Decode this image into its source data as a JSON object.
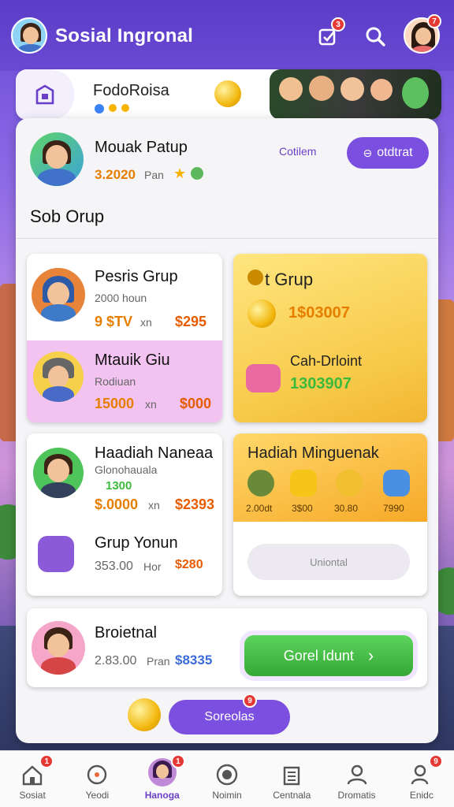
{
  "app": {
    "title": "Sosial Ingronal"
  },
  "topbar": {
    "notify_badge": "3",
    "profile_badge": "7"
  },
  "banner": {
    "title": "FodoRoisa"
  },
  "profile": {
    "name": "Mouak Patup",
    "value": "3.2020",
    "value_suffix": "Pan",
    "link": "Cotilem",
    "button": "otdtrat"
  },
  "section_title": "Sob Orup",
  "groups_card": {
    "items": [
      {
        "name": "Pesris Grup",
        "sub": "2000 houn",
        "price_left": "9 $TV",
        "price_mid": "xn",
        "price_right": "$295"
      },
      {
        "name": "Mtauik Giu",
        "sub": "Rodiuan",
        "price_left": "15000",
        "price_mid": "xn",
        "price_right": "$000"
      }
    ]
  },
  "grup_gold": {
    "title": "t Grup",
    "rows": [
      {
        "label": "",
        "value": "1$03007"
      },
      {
        "label": "Cah-Drloint",
        "value": "1303907"
      }
    ]
  },
  "hadiah_card": {
    "items": [
      {
        "name": "Haadiah Naneaa",
        "sub": "Glonohauala",
        "green_price": "1300",
        "price_left": "$.0000",
        "price_mid": "xn",
        "price_right": "$2393"
      },
      {
        "name": "Grup Yonun",
        "sub": "",
        "price_left": "353.00",
        "price_mid": "Hor",
        "price_right": "$280"
      }
    ]
  },
  "hadiah_gold": {
    "title": "Hadiah Minguenak",
    "prizes": [
      "2.00dt",
      "3$00",
      "30.80",
      "7990"
    ],
    "input_placeholder": "Uniontal"
  },
  "bottom_card": {
    "name": "Broietnal",
    "price": "2.83.00",
    "price_suffix": "Pran",
    "price_right": "$8335",
    "cta": "Gorel Idunt",
    "float_button": "Soreolas",
    "float_badge": "9"
  },
  "nav": {
    "items": [
      {
        "label": "Sosiat",
        "icon": "home-icon",
        "badge": "1"
      },
      {
        "label": "Yeodi",
        "icon": "circle-icon",
        "badge": ""
      },
      {
        "label": "Hanoga",
        "icon": "avatar-icon",
        "badge": "1",
        "active": true
      },
      {
        "label": "Noimin",
        "icon": "record-icon",
        "badge": ""
      },
      {
        "label": "Centnala",
        "icon": "building-icon",
        "badge": ""
      },
      {
        "label": "Dromatis",
        "icon": "person-icon",
        "badge": ""
      },
      {
        "label": "Enidc",
        "icon": "search-user-icon",
        "badge": "9"
      }
    ]
  },
  "colors": {
    "accent": "#7b4fe0",
    "gold": "#f7c948",
    "green": "#3cba3c",
    "badge": "#e53935"
  }
}
